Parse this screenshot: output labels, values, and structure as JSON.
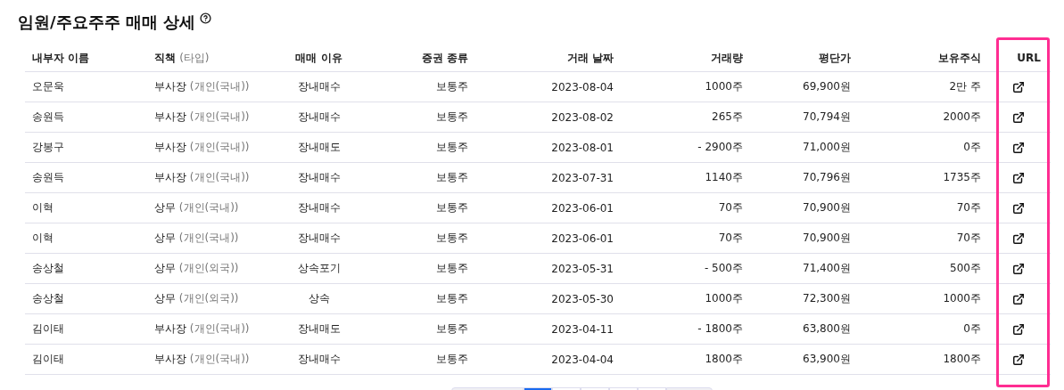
{
  "title": "임원/주요주주 매매 상세",
  "table": {
    "columns": [
      "내부자 이름",
      {
        "main": "직책",
        "sub": "(타입)"
      },
      "매매 이유",
      "증권 종류",
      "거래 날짜",
      "거래량",
      "평단가",
      "보유주식",
      "URL"
    ],
    "url_column_highlighted": true,
    "rows": [
      {
        "name": "오문욱",
        "position": "부사장",
        "type": "(개인(국내))",
        "reason": "장내매수",
        "security": "보통주",
        "date": "2023-08-04",
        "volume": "1000주",
        "price": "69,900원",
        "holding": "2만 주"
      },
      {
        "name": "송원득",
        "position": "부사장",
        "type": "(개인(국내))",
        "reason": "장내매수",
        "security": "보통주",
        "date": "2023-08-02",
        "volume": "265주",
        "price": "70,794원",
        "holding": "2000주"
      },
      {
        "name": "강봉구",
        "position": "부사장",
        "type": "(개인(국내))",
        "reason": "장내매도",
        "security": "보통주",
        "date": "2023-08-01",
        "volume": "- 2900주",
        "price": "71,000원",
        "holding": "0주"
      },
      {
        "name": "송원득",
        "position": "부사장",
        "type": "(개인(국내))",
        "reason": "장내매수",
        "security": "보통주",
        "date": "2023-07-31",
        "volume": "1140주",
        "price": "70,796원",
        "holding": "1735주"
      },
      {
        "name": "이혁",
        "position": "상무",
        "type": "(개인(국내))",
        "reason": "장내매수",
        "security": "보통주",
        "date": "2023-06-01",
        "volume": "70주",
        "price": "70,900원",
        "holding": "70주"
      },
      {
        "name": "이혁",
        "position": "상무",
        "type": "(개인(국내))",
        "reason": "장내매수",
        "security": "보통주",
        "date": "2023-06-01",
        "volume": "70주",
        "price": "70,900원",
        "holding": "70주"
      },
      {
        "name": "송상철",
        "position": "상무",
        "type": "(개인(외국))",
        "reason": "상속포기",
        "security": "보통주",
        "date": "2023-05-31",
        "volume": "- 500주",
        "price": "71,400원",
        "holding": "500주"
      },
      {
        "name": "송상철",
        "position": "상무",
        "type": "(개인(외국))",
        "reason": "상속",
        "security": "보통주",
        "date": "2023-05-30",
        "volume": "1000주",
        "price": "72,300원",
        "holding": "1000주"
      },
      {
        "name": "김이태",
        "position": "부사장",
        "type": "(개인(국내))",
        "reason": "장내매도",
        "security": "보통주",
        "date": "2023-04-11",
        "volume": "- 1800주",
        "price": "63,800원",
        "holding": "0주"
      },
      {
        "name": "김이태",
        "position": "부사장",
        "type": "(개인(국내))",
        "reason": "장내매수",
        "security": "보통주",
        "date": "2023-04-04",
        "volume": "1800주",
        "price": "63,900원",
        "holding": "1800주"
      }
    ]
  },
  "pagination": [
    {
      "kind": "wide",
      "selected": false
    },
    {
      "kind": "page",
      "selected": true
    },
    {
      "kind": "page",
      "selected": false
    },
    {
      "kind": "page",
      "selected": false
    },
    {
      "kind": "page",
      "selected": false
    },
    {
      "kind": "page",
      "selected": false
    },
    {
      "kind": "wide",
      "selected": false
    }
  ]
}
